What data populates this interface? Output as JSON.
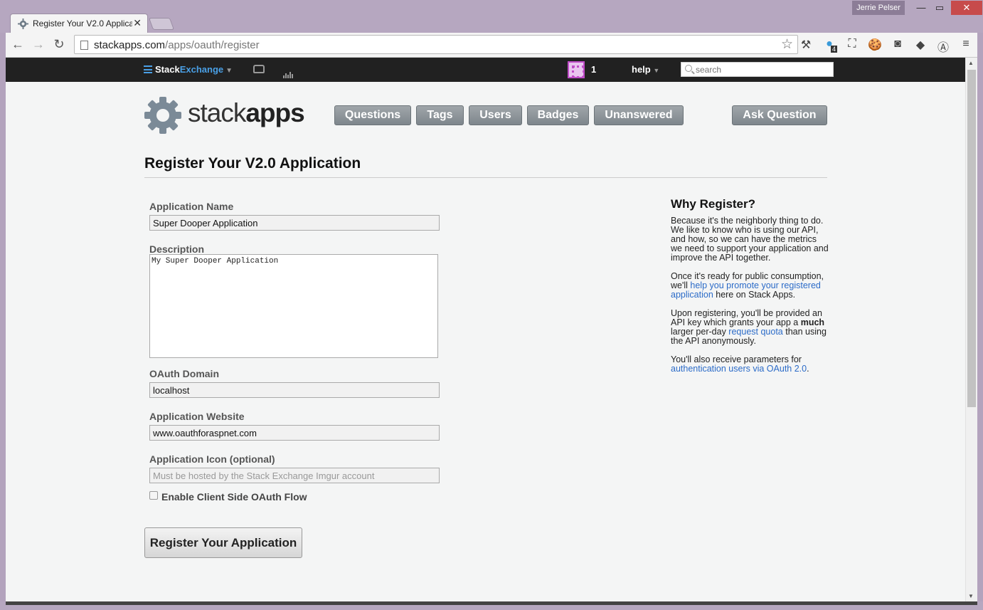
{
  "browser": {
    "tab_title": "Register Your V2.0 Applica",
    "profile_name": "Jerrie Pelser",
    "url_host": "stackapps.com",
    "url_path": "/apps/oauth/register",
    "extension_badge": "4"
  },
  "topbar": {
    "brand_stack": "Stack",
    "brand_exchange": "Exchange",
    "reputation": "1",
    "help_label": "help",
    "search_placeholder": "search"
  },
  "header": {
    "logo_light": "stack",
    "logo_bold": "apps",
    "nav": [
      "Questions",
      "Tags",
      "Users",
      "Badges",
      "Unanswered"
    ],
    "ask_label": "Ask Question"
  },
  "form": {
    "title": "Register Your V2.0 Application",
    "name_label": "Application Name",
    "name_value": "Super Dooper Application",
    "desc_label": "Description",
    "desc_value": "My Super Dooper Application",
    "domain_label": "OAuth Domain",
    "domain_value": "localhost",
    "website_label": "Application Website",
    "website_value": "www.oauthforaspnet.com",
    "icon_label": "Application Icon (optional)",
    "icon_placeholder": "Must be hosted by the Stack Exchange Imgur account",
    "client_flow_label": "Enable Client Side OAuth Flow",
    "client_flow_checked": false,
    "submit_label": "Register Your Application"
  },
  "sidebar": {
    "heading": "Why Register?",
    "p1": "Because it's the neighborly thing to do. We like to know who is using our API, and how, so we can have the metrics we need to support your application and improve the API together.",
    "p2_pre": "Once it's ready for public consumption, we'll ",
    "p2_link": "help you promote your registered application",
    "p2_post": " here on Stack Apps.",
    "p3_pre": "Upon registering, you'll be provided an API key which grants your app a ",
    "p3_bold": "much",
    "p3_mid": " larger per-day ",
    "p3_link": "request quota",
    "p3_post": " than using the API anonymously.",
    "p4_pre": "You'll also receive parameters for ",
    "p4_link": "authentication users via OAuth 2.0",
    "p4_post": "."
  },
  "colors": {
    "link": "#2b6bc8",
    "se_bar": "#212121",
    "brand_blue": "#4aa0e6",
    "nav_button": "#8a9196"
  }
}
